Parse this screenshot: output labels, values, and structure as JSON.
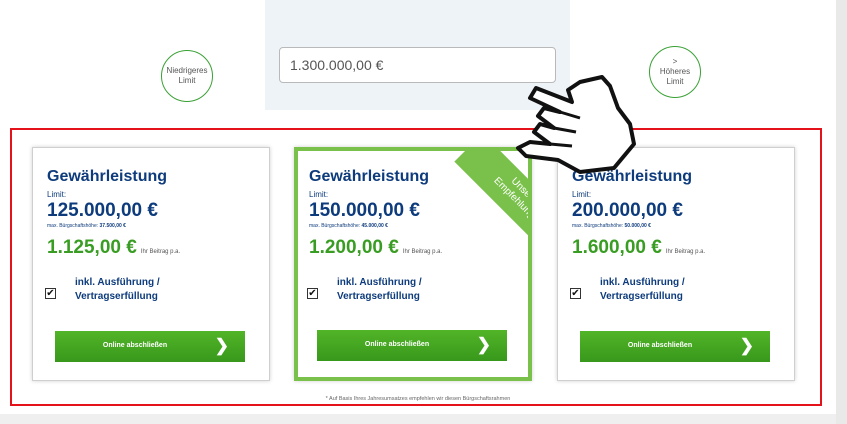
{
  "limit_input": {
    "value": "1.300.000,00 €"
  },
  "controls": {
    "lower_label": "Niedrigeres\nLimit",
    "higher_label": ">\nHöheres\nLimit"
  },
  "cards": [
    {
      "title": "Gewährleistung",
      "limit_label": "Limit:",
      "limit_value": "125.000,00 €",
      "max_label": "max. Bürgschaftshöhe:",
      "max_value": "37.500,00 €",
      "price": "1.125,00 €",
      "price_note": "Ihr Beitrag p.a.",
      "checkbox_label": "inkl. Ausführung /\nVertragserfüllung",
      "checked": true,
      "cta_label": "Online abschließen"
    },
    {
      "title": "Gewährleistung",
      "limit_label": "Limit:",
      "limit_value": "150.000,00 €",
      "max_label": "max. Bürgschaftshöhe:",
      "max_value": "45.000,00 €",
      "price": "1.200,00 €",
      "price_note": "Ihr Beitrag p.a.",
      "checkbox_label": "inkl. Ausführung /\nVertragserfüllung",
      "checked": true,
      "cta_label": "Online abschließen",
      "ribbon": "Unsere\nEmpfehlung*"
    },
    {
      "title": "Gewährleistung",
      "limit_label": "Limit:",
      "limit_value": "200.000,00 €",
      "max_label": "max. Bürgschaftshöhe:",
      "max_value": "50.000,00 €",
      "price": "1.600,00 €",
      "price_note": "Ihr Beitrag p.a.",
      "checkbox_label": "inkl. Ausführung /\nVertragserfüllung",
      "checked": true,
      "cta_label": "Online abschließen"
    }
  ],
  "footnote": "* Auf Basis Ihres Jahresumsatzes empfehlen wir diesen Bürgschaftsrahmen",
  "icons": {
    "cta_arrow": "chevron-right-icon",
    "checkbox_mark": "checkmark-icon",
    "pointer": "hand-pointer-icon"
  },
  "colors": {
    "accent_green": "#3a9d23",
    "recommend_green": "#79c14a",
    "title_blue": "#0d3b7c",
    "highlight_red": "#e3121b"
  }
}
